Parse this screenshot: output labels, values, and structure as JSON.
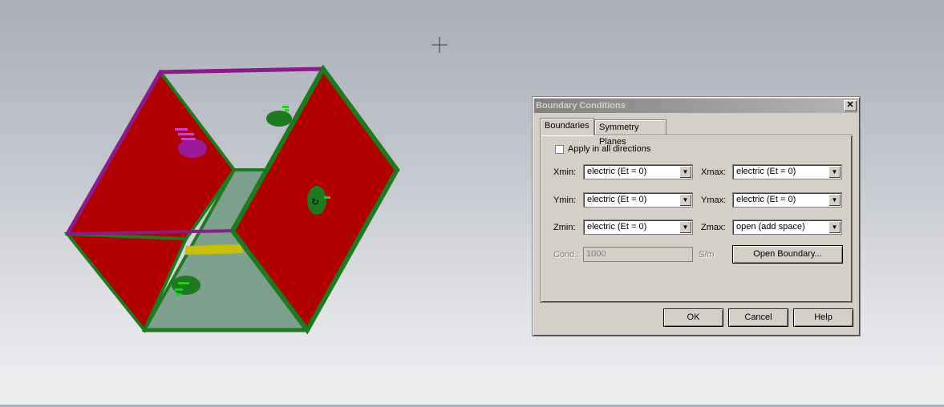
{
  "dialog": {
    "title": "Boundary Conditions",
    "close_glyph": "✕",
    "tabs": [
      {
        "label": "Boundaries",
        "active": true
      },
      {
        "label": "Symmetry Planes",
        "active": false
      }
    ],
    "apply_all_label": "Apply in all directions",
    "apply_all_checked": false,
    "fields": {
      "xmin": {
        "label": "Xmin:",
        "value": "electric (Et = 0)"
      },
      "xmax": {
        "label": "Xmax:",
        "value": "electric (Et = 0)"
      },
      "ymin": {
        "label": "Ymin:",
        "value": "electric (Et = 0)"
      },
      "ymax": {
        "label": "Ymax:",
        "value": "electric (Et = 0)"
      },
      "zmin": {
        "label": "Zmin:",
        "value": "electric (Et = 0)"
      },
      "zmax": {
        "label": "Zmax:",
        "value": "open (add space)"
      }
    },
    "cond_label": "Cond.:",
    "cond_value": "1000",
    "cond_unit": "S/m",
    "open_boundary_label": "Open Boundary...",
    "buttons": {
      "ok": "OK",
      "cancel": "Cancel",
      "help": "Help"
    }
  },
  "colors": {
    "wall_red": "#b00000",
    "edge_green": "#1e7a1e",
    "edge_purple": "#8b1a8b",
    "floor_gray": "#7ea08e",
    "strip_yellow": "#c8c000",
    "dialog_bg": "#d4d0c8"
  },
  "icons": [
    "crosshair-cursor-icon",
    "port-marker-icon",
    "close-icon",
    "dropdown-arrow-icon"
  ]
}
